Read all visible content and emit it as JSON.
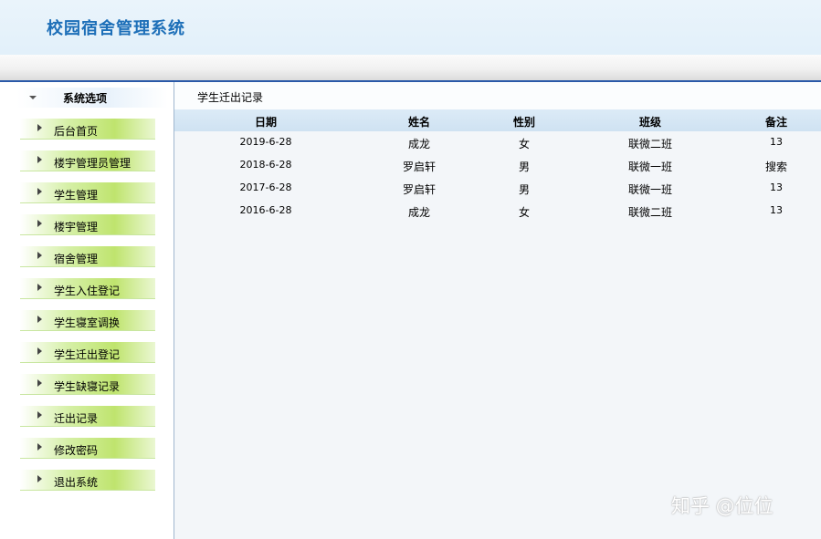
{
  "header": {
    "title": "校园宿舍管理系统"
  },
  "sidebar": {
    "title": "系统选项",
    "items": [
      {
        "label": "后台首页"
      },
      {
        "label": "楼宇管理员管理"
      },
      {
        "label": "学生管理"
      },
      {
        "label": "楼宇管理"
      },
      {
        "label": "宿舍管理"
      },
      {
        "label": "学生入住登记"
      },
      {
        "label": "学生寝室调换"
      },
      {
        "label": "学生迁出登记"
      },
      {
        "label": "学生缺寝记录"
      },
      {
        "label": "迁出记录"
      },
      {
        "label": "修改密码"
      },
      {
        "label": "退出系统"
      }
    ]
  },
  "main": {
    "breadcrumb": "学生迁出记录",
    "table": {
      "columns": [
        "日期",
        "姓名",
        "性别",
        "班级",
        "备注"
      ],
      "rows": [
        [
          "2019-6-28",
          "成龙",
          "女",
          "联微二班",
          "13"
        ],
        [
          "2018-6-28",
          "罗启轩",
          "男",
          "联微一班",
          "搜索"
        ],
        [
          "2017-6-28",
          "罗启轩",
          "男",
          "联微一班",
          "13"
        ],
        [
          "2016-6-28",
          "成龙",
          "女",
          "联微二班",
          "13"
        ]
      ]
    }
  },
  "watermark": "知乎 @位位"
}
